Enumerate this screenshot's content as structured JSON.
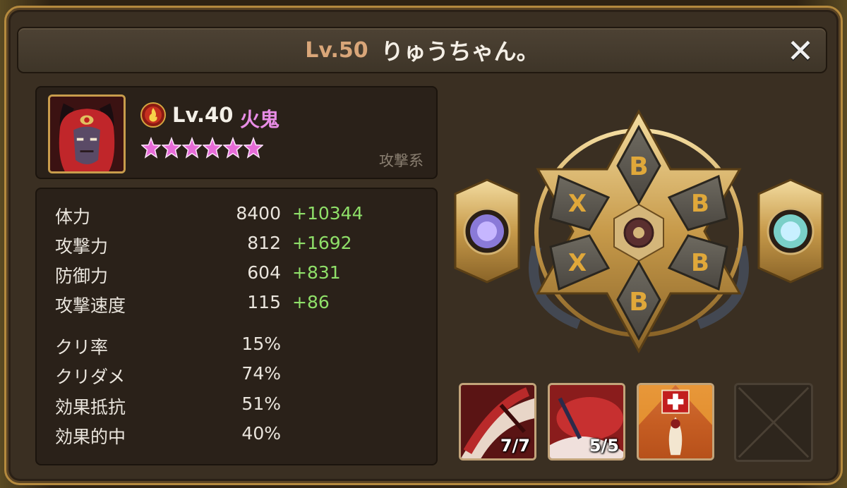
{
  "title": {
    "level": "Lv.50",
    "name": "りゅうちゃん。"
  },
  "close": {
    "glyph": "✕",
    "icon": "close-icon"
  },
  "monster": {
    "attribute_icon": "fire-attribute-icon",
    "level": "Lv.40",
    "name": "火鬼",
    "stars": 6,
    "type": "攻撃系",
    "name_color": "#e88de6"
  },
  "stats": {
    "base": [
      {
        "label": "体力",
        "value": "8400",
        "bonus": "+10344"
      },
      {
        "label": "攻撃力",
        "value": "812",
        "bonus": "+1692"
      },
      {
        "label": "防御力",
        "value": "604",
        "bonus": "+831"
      },
      {
        "label": "攻撃速度",
        "value": "115",
        "bonus": "+86"
      }
    ],
    "extra": [
      {
        "label": "クリ率",
        "value": "15%"
      },
      {
        "label": "クリダメ",
        "value": "74%"
      },
      {
        "label": "効果抵抗",
        "value": "51%"
      },
      {
        "label": "効果的中",
        "value": "40%"
      }
    ],
    "bonus_color": "#8fe069"
  },
  "runes": {
    "slots": [
      "B",
      "B",
      "B",
      "B",
      "X",
      "X"
    ],
    "artifact_left": "artifact-attribute-icon",
    "artifact_right": "artifact-type-icon"
  },
  "skills": [
    {
      "level": "7/7",
      "icon": "fire-slash-icon"
    },
    {
      "level": "5/5",
      "icon": "red-dragon-strike-icon"
    },
    {
      "level": "",
      "icon": "holy-banner-icon"
    },
    {
      "level": "",
      "icon": "empty-skill-slot"
    }
  ]
}
